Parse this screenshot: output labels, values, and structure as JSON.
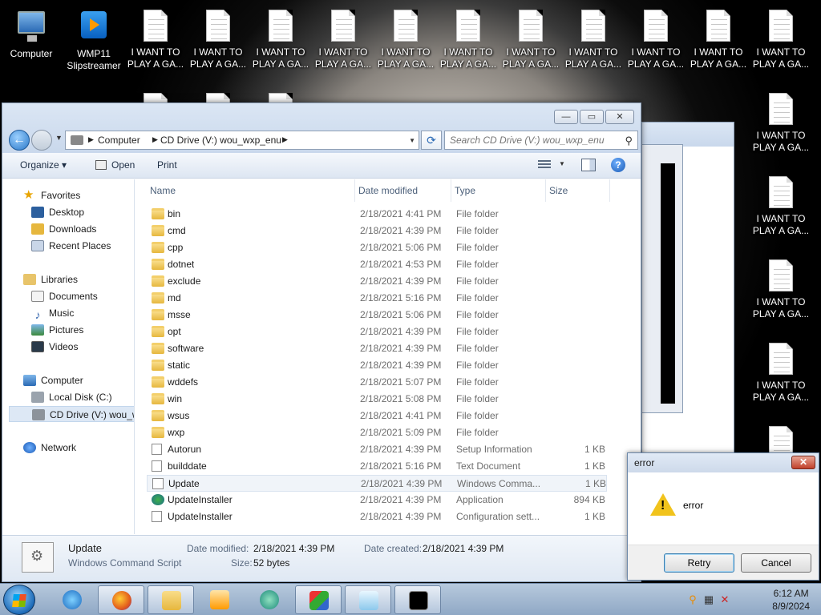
{
  "desktop": {
    "icons": [
      {
        "label_1": "Computer",
        "label_2": ""
      },
      {
        "label_1": "WMP11",
        "label_2": "Slipstreamer"
      },
      {
        "label_1": "I WANT TO",
        "label_2": "PLAY A GA..."
      }
    ]
  },
  "explorer": {
    "breadcrumb": [
      "Computer",
      "CD Drive (V:) wou_wxp_enu"
    ],
    "search_placeholder": "Search CD Drive (V:) wou_wxp_enu",
    "toolbar": {
      "organize": "Organize",
      "open": "Open",
      "print": "Print"
    },
    "nav": {
      "favorites": "Favorites",
      "desktop": "Desktop",
      "downloads": "Downloads",
      "recent_places": "Recent Places",
      "libraries": "Libraries",
      "documents": "Documents",
      "music": "Music",
      "pictures": "Pictures",
      "videos": "Videos",
      "computer": "Computer",
      "local_disk": "Local Disk (C:)",
      "cd_drive": "CD Drive (V:) wou_w",
      "network": "Network"
    },
    "columns": {
      "name": "Name",
      "date": "Date modified",
      "type": "Type",
      "size": "Size"
    },
    "files": [
      {
        "name": "bin",
        "date": "2/18/2021 4:41 PM",
        "type": "File folder",
        "size": "",
        "icon": "folder"
      },
      {
        "name": "cmd",
        "date": "2/18/2021 4:39 PM",
        "type": "File folder",
        "size": "",
        "icon": "folder"
      },
      {
        "name": "cpp",
        "date": "2/18/2021 5:06 PM",
        "type": "File folder",
        "size": "",
        "icon": "folder"
      },
      {
        "name": "dotnet",
        "date": "2/18/2021 4:53 PM",
        "type": "File folder",
        "size": "",
        "icon": "folder"
      },
      {
        "name": "exclude",
        "date": "2/18/2021 4:39 PM",
        "type": "File folder",
        "size": "",
        "icon": "folder"
      },
      {
        "name": "md",
        "date": "2/18/2021 5:16 PM",
        "type": "File folder",
        "size": "",
        "icon": "folder"
      },
      {
        "name": "msse",
        "date": "2/18/2021 5:06 PM",
        "type": "File folder",
        "size": "",
        "icon": "folder"
      },
      {
        "name": "opt",
        "date": "2/18/2021 4:39 PM",
        "type": "File folder",
        "size": "",
        "icon": "folder"
      },
      {
        "name": "software",
        "date": "2/18/2021 4:39 PM",
        "type": "File folder",
        "size": "",
        "icon": "folder"
      },
      {
        "name": "static",
        "date": "2/18/2021 4:39 PM",
        "type": "File folder",
        "size": "",
        "icon": "folder"
      },
      {
        "name": "wddefs",
        "date": "2/18/2021 5:07 PM",
        "type": "File folder",
        "size": "",
        "icon": "folder"
      },
      {
        "name": "win",
        "date": "2/18/2021 5:08 PM",
        "type": "File folder",
        "size": "",
        "icon": "folder"
      },
      {
        "name": "wsus",
        "date": "2/18/2021 4:41 PM",
        "type": "File folder",
        "size": "",
        "icon": "folder"
      },
      {
        "name": "wxp",
        "date": "2/18/2021 5:09 PM",
        "type": "File folder",
        "size": "",
        "icon": "folder"
      },
      {
        "name": "Autorun",
        "date": "2/18/2021 4:39 PM",
        "type": "Setup Information",
        "size": "1 KB",
        "icon": "file"
      },
      {
        "name": "builddate",
        "date": "2/18/2021 5:16 PM",
        "type": "Text Document",
        "size": "1 KB",
        "icon": "file"
      },
      {
        "name": "Update",
        "date": "2/18/2021 4:39 PM",
        "type": "Windows Comma...",
        "size": "1 KB",
        "icon": "cmd"
      },
      {
        "name": "UpdateInstaller",
        "date": "2/18/2021 4:39 PM",
        "type": "Application",
        "size": "894 KB",
        "icon": "app"
      },
      {
        "name": "UpdateInstaller",
        "date": "2/18/2021 4:39 PM",
        "type": "Configuration sett...",
        "size": "1 KB",
        "icon": "file"
      }
    ],
    "details": {
      "name": "Update",
      "type": "Windows Command Script",
      "date_modified_label": "Date modified:",
      "date_modified": "2/18/2021 4:39 PM",
      "date_created_label": "Date created:",
      "date_created": "2/18/2021 4:39 PM",
      "size_label": "Size:",
      "size": "52 bytes"
    }
  },
  "dialog": {
    "title": "error",
    "message": "error",
    "retry": "Retry",
    "cancel": "Cancel"
  },
  "taskbar": {
    "time": "6:12 AM",
    "date": "8/9/2024"
  }
}
